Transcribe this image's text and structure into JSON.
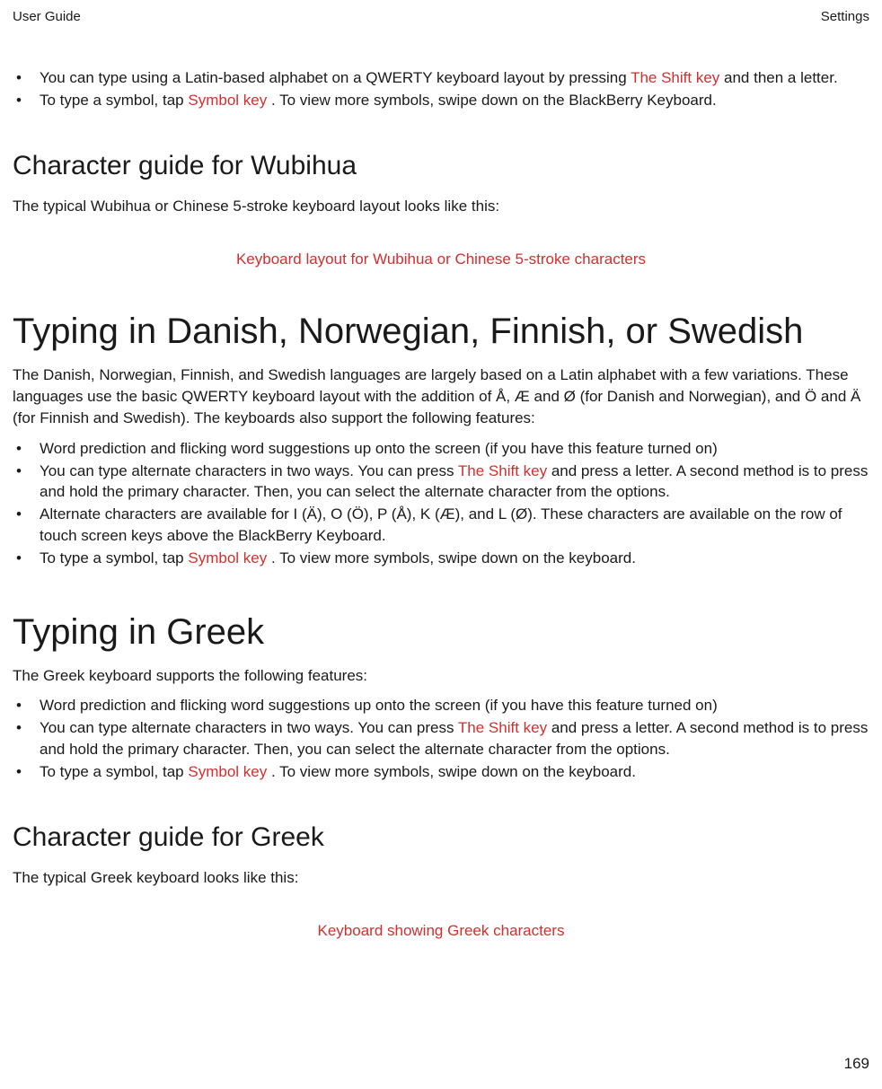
{
  "header": {
    "left": "User Guide",
    "right": "Settings"
  },
  "topList": {
    "item1_a": "You can type using a Latin-based alphabet on a QWERTY keyboard layout by pressing ",
    "item1_b": " The Shift key ",
    "item1_c": " and then a letter.",
    "item2_a": "To type a symbol, tap ",
    "item2_b": " Symbol key ",
    "item2_c": ". To view more symbols, swipe down on the BlackBerry Keyboard."
  },
  "wubihua": {
    "heading": "Character guide for Wubihua",
    "desc": "The typical Wubihua or Chinese 5-stroke keyboard layout looks like this:",
    "figcaption": "Keyboard layout for Wubihua or Chinese 5-stroke characters"
  },
  "nordic": {
    "heading": "Typing in Danish, Norwegian, Finnish, or Swedish",
    "desc": "The Danish, Norwegian, Finnish, and Swedish languages are largely based on a Latin alphabet with a few variations. These languages use the basic QWERTY keyboard layout with the addition of Å, Æ and Ø (for Danish and Norwegian), and Ö and Ä (for Finnish and Swedish). The keyboards also support the following features:",
    "item1": "Word prediction and flicking word suggestions up onto the screen (if you have this feature turned on)",
    "item2_a": "You can type alternate characters in two ways. You can press ",
    "item2_b": " The Shift key ",
    "item2_c": " and press a letter. A second method is to press and hold the primary character. Then, you can select the alternate character from the options.",
    "item3": "Alternate characters are available for I (Ä), O (Ö), P (Å), K (Æ), and L (Ø). These characters are available on the row of touch screen keys above the BlackBerry Keyboard.",
    "item4_a": "To type a symbol, tap ",
    "item4_b": " Symbol key ",
    "item4_c": ". To view more symbols, swipe down on the keyboard."
  },
  "greek": {
    "heading": "Typing in Greek",
    "desc": "The Greek keyboard supports the following features:",
    "item1": "Word prediction and flicking word suggestions up onto the screen (if you have this feature turned on)",
    "item2_a": "You can type alternate characters in two ways. You can press ",
    "item2_b": " The Shift key ",
    "item2_c": " and press a letter. A second method is to press and hold the primary character. Then, you can select the alternate character from the options.",
    "item3_a": "To type a symbol, tap ",
    "item3_b": " Symbol key ",
    "item3_c": ". To view more symbols, swipe down on the keyboard."
  },
  "greekGuide": {
    "heading": "Character guide for Greek",
    "desc": "The typical Greek keyboard looks like this:",
    "figcaption": "Keyboard showing Greek characters"
  },
  "pageNumber": "169"
}
